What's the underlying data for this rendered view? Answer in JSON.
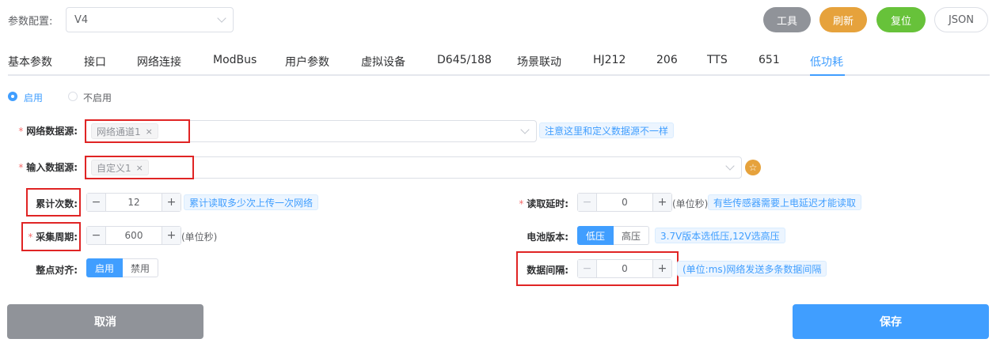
{
  "header": {
    "config_label": "参数配置:",
    "config_value": "V4",
    "buttons": {
      "tools": "工具",
      "refresh": "刷新",
      "reset": "复位",
      "json": "JSON"
    }
  },
  "tabs": [
    "基本参数",
    "接口",
    "网络连接",
    "ModBus",
    "用户参数",
    "虚拟设备",
    "D645/188",
    "场景联动",
    "HJ212",
    "206",
    "TTS",
    "651",
    "低功耗"
  ],
  "active_tab": "低功耗",
  "enable_radio": {
    "on_label": "启用",
    "off_label": "不启用",
    "selected": "启用"
  },
  "form": {
    "net_source": {
      "label": "网络数据源:",
      "tag": "网络通道1",
      "hint": "注意这里和定义数据源不一样"
    },
    "input_source": {
      "label": "输入数据源:",
      "tag": "自定义1"
    },
    "accum_count": {
      "label": "累计次数:",
      "value": "12",
      "hint": "累计读取多少次上传一次网络"
    },
    "read_delay": {
      "label": "读取延时:",
      "value": "0",
      "unit": "(单位秒)",
      "hint": "有些传感器需要上电延迟才能读取"
    },
    "collect_period": {
      "label": "采集周期:",
      "value": "600",
      "unit": "(单位秒)"
    },
    "battery_version": {
      "label": "电池版本:",
      "options": [
        "低压",
        "高压"
      ],
      "selected": "低压",
      "hint": "3.7V版本选低压,12V选高压"
    },
    "align_hour": {
      "label": "整点对齐:",
      "options": [
        "启用",
        "禁用"
      ],
      "selected": "启用"
    },
    "data_interval": {
      "label": "数据间隔:",
      "value": "0",
      "hint": "(单位:ms)网络发送多条数据间隔"
    }
  },
  "footer": {
    "cancel": "取消",
    "save": "保存"
  },
  "colors": {
    "primary": "#409eff",
    "warning": "#e6a23c",
    "success": "#67c23a",
    "info": "#909399",
    "highlight": "#e02424"
  }
}
